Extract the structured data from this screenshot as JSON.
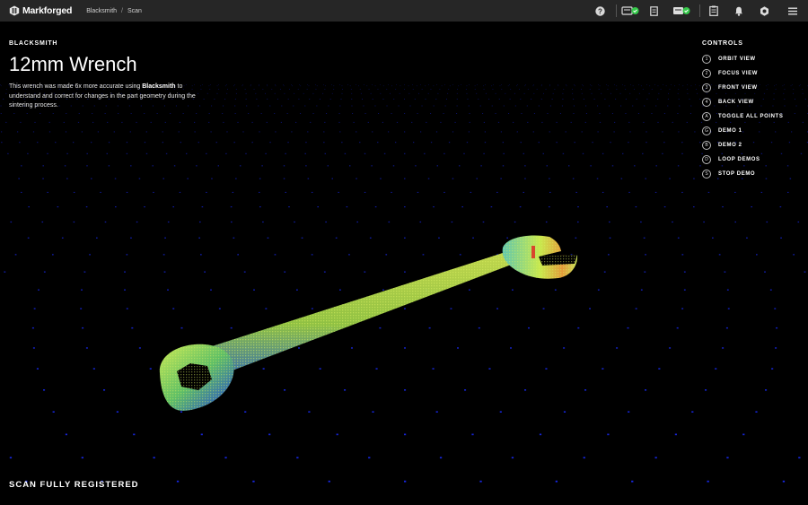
{
  "topbar": {
    "brand": "Markforged",
    "breadcrumb": [
      "Blacksmith",
      "Scan"
    ],
    "icons": [
      "help-icon",
      "printer-status-icon",
      "document-icon",
      "devices-status-icon",
      "clipboard-icon",
      "bell-icon",
      "settings-icon",
      "menu-icon"
    ]
  },
  "panel": {
    "eyebrow": "BLACKSMITH",
    "title": "12mm Wrench",
    "description_pre": "This wrench was made 6x more accurate using ",
    "description_bold": "Blacksmith",
    "description_post": " to understand and correct for changes in the part geometry during the sintering process."
  },
  "controls": {
    "heading": "CONTROLS",
    "items": [
      {
        "key": "1",
        "label": "ORBIT VIEW"
      },
      {
        "key": "2",
        "label": "FOCUS VIEW"
      },
      {
        "key": "3",
        "label": "FRONT VIEW"
      },
      {
        "key": "4",
        "label": "BACK VIEW"
      },
      {
        "key": "A",
        "label": "TOGGLE ALL POINTS"
      },
      {
        "key": "G",
        "label": "DEMO 1"
      },
      {
        "key": "B",
        "label": "DEMO 2"
      },
      {
        "key": "D",
        "label": "LOOP DEMOS"
      },
      {
        "key": "S",
        "label": "STOP DEMO"
      }
    ]
  },
  "status": "SCAN FULLY REGISTERED",
  "colors": {
    "background": "#000000",
    "topbar": "#262626",
    "grid_point": "#1a2cff",
    "scan_low": "#1c3fd8",
    "scan_mid": "#b8e04a",
    "scan_high": "#d9462c",
    "ok_badge": "#35c94a"
  }
}
